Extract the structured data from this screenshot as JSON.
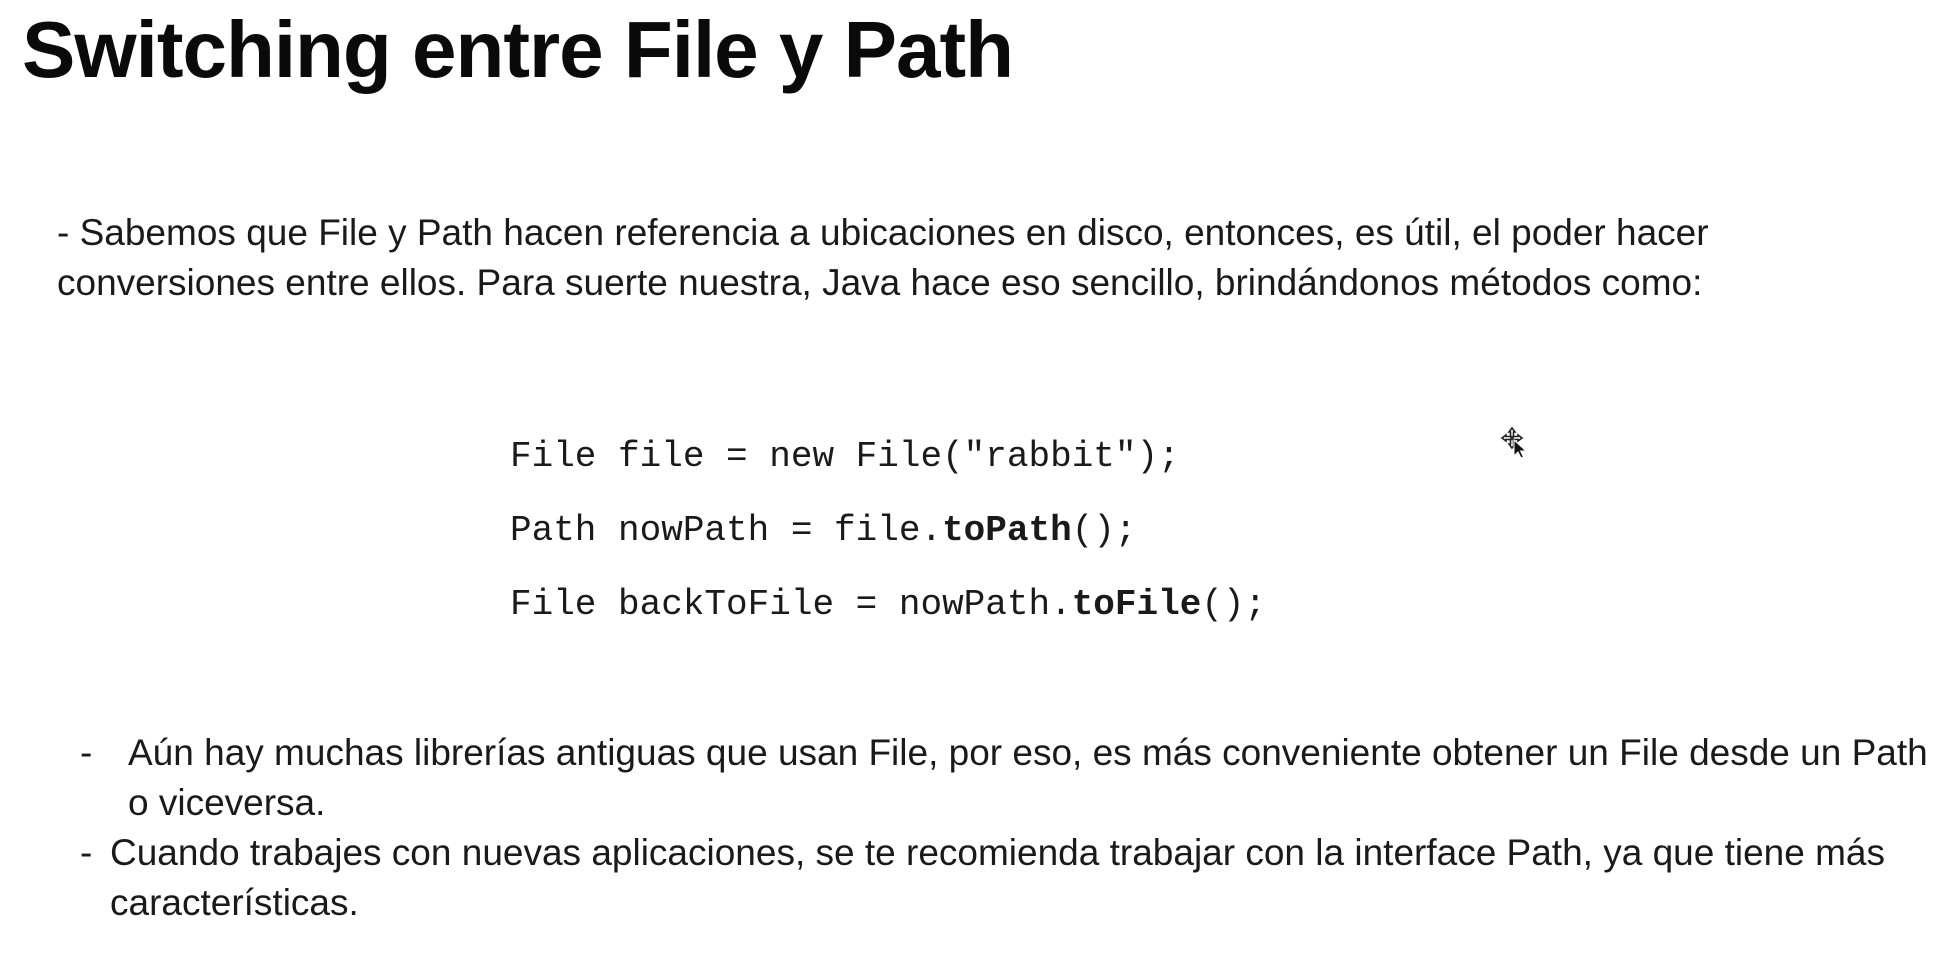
{
  "slide": {
    "title": "Switching entre File y Path",
    "intro": "- Sabemos que File y Path hacen referencia a ubicaciones en disco, entonces, es útil, el poder hacer conversiones entre ellos. Para suerte nuestra, Java hace eso sencillo, brindándonos métodos como:",
    "code": [
      {
        "pre": "File file = new File(\"rabbit\");",
        "bold": "",
        "post": ""
      },
      {
        "pre": "Path nowPath = file.",
        "bold": "toPath",
        "post": "();"
      },
      {
        "pre": "File backToFile = nowPath.",
        "bold": "toFile",
        "post": "();"
      }
    ],
    "bullets": [
      {
        "marker": "-",
        "text": "Aún hay muchas librerías antiguas que usan File, por eso, es más conveniente obtener un File desde un Path o viceversa."
      },
      {
        "marker": "-",
        "text": "Cuando trabajes con nuevas aplicaciones, se te recomienda trabajar con la interface Path, ya que tiene más características."
      }
    ]
  },
  "icons": {
    "cursor": "move-cursor-icon"
  }
}
